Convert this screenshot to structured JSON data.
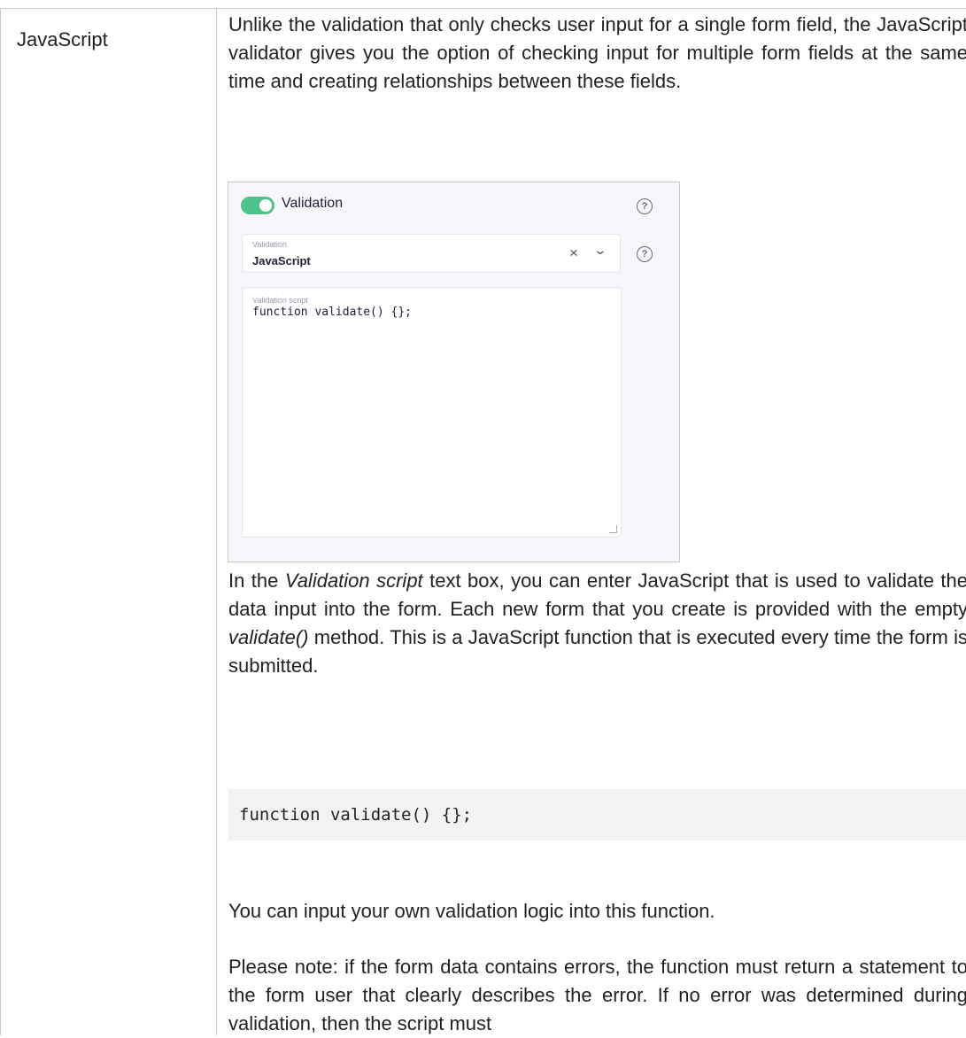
{
  "row": {
    "term": "JavaScript",
    "intro": "Unlike the validation that only checks user input for a single form field, the JavaScript validator gives you the option of checking input for multiple form fields at the same time and creating relationships between these fields.",
    "screenshot": {
      "toggle_label": "Validation",
      "select_label": "Validation",
      "select_value": "JavaScript",
      "clear_glyph": "×",
      "chevron_glyph": "⌄",
      "help_glyph": "?",
      "script_label": "Validation script",
      "script_code": "function validate() {};"
    },
    "para2_a": "In the ",
    "para2_em1": "Validation script",
    "para2_b": " text box, you can enter JavaScript that is used to validate the data input into the form. Each new form that you create is provided with the empty ",
    "para2_em2": "validate()",
    "para2_c": " method. This is a JavaScript function that is executed every time the form is submitted.",
    "code_block": "function validate() {};",
    "para3": "You can input your own validation logic into this function.",
    "para4": "Please note: if the form data contains errors, the function must return a statement to the form user that clearly describes the error. If no error was determined during validation, then the script must"
  }
}
